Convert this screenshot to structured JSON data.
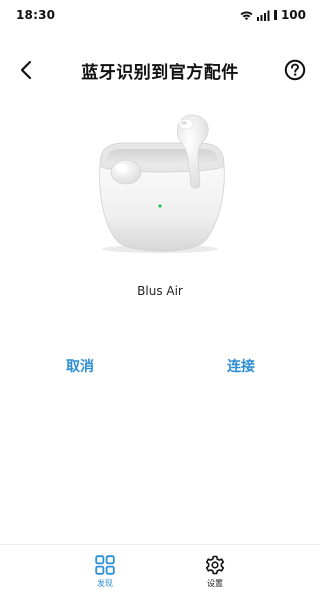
{
  "status_bar": {
    "time": "18:30",
    "battery": "100",
    "icons": [
      "wifi-icon",
      "signal-icon",
      "battery-icon"
    ]
  },
  "header": {
    "title": "蓝牙识别到官方配件",
    "back_icon": "chevron-left-icon",
    "help_icon": "help-circle-icon"
  },
  "device": {
    "image": "earbuds-case-image",
    "name": "Blus Air"
  },
  "actions": {
    "cancel_label": "取消",
    "connect_label": "连接"
  },
  "bottom_nav": {
    "items": [
      {
        "label": "发现",
        "icon": "grid-icon",
        "active": true
      },
      {
        "label": "设置",
        "icon": "gear-icon",
        "active": false
      }
    ]
  },
  "colors": {
    "accent": "#2d8fd5",
    "text": "#111111",
    "background": "#ffffff"
  }
}
